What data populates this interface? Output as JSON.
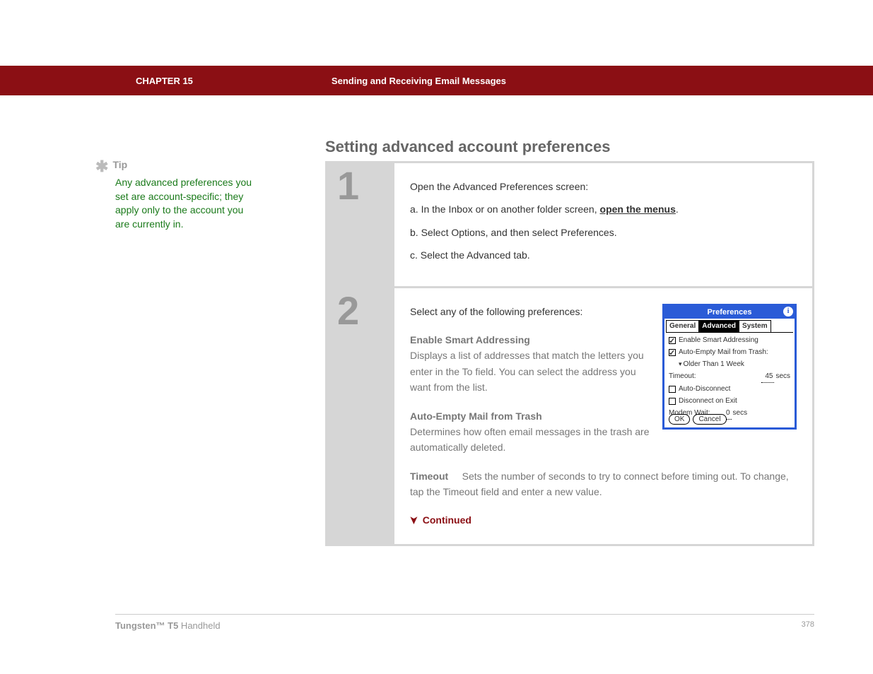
{
  "header": {
    "chapter": "CHAPTER 15",
    "title": "Sending and Receiving Email Messages"
  },
  "sidebar": {
    "tip_label": "Tip",
    "tip_text": "Any advanced preferences you set are account-specific; they apply only to the account you are currently in."
  },
  "section_title": "Setting advanced account preferences",
  "step1": {
    "num": "1",
    "intro": "Open the Advanced Preferences screen:",
    "a_prefix": "a.  In the Inbox or on another folder screen, ",
    "a_link": "open the menus",
    "a_suffix": ".",
    "b": "b.  Select Options, and then select Preferences.",
    "c": "c.  Select the Advanced tab."
  },
  "step2": {
    "num": "2",
    "intro": "Select any of the following preferences:",
    "pref1_title": "Enable Smart Addressing",
    "pref1_desc": "Displays a list of addresses that match the letters you enter in the To field. You can select the address you want from the list.",
    "pref2_title": "Auto-Empty Mail from Trash",
    "pref2_desc": "Determines how often email messages in the trash are automatically deleted.",
    "pref3_title": "Timeout",
    "pref3_desc": "Sets the number of seconds to try to connect before timing out. To change, tap the Timeout field and enter a new value.",
    "continued": "Continued"
  },
  "screenshot": {
    "title": "Preferences",
    "tabs": {
      "general": "General",
      "advanced": "Advanced",
      "system": "System"
    },
    "chk1": "Enable Smart Addressing",
    "chk2": "Auto-Empty Mail from Trash:",
    "sub": "Older Than 1 Week",
    "timeout_label": "Timeout:",
    "timeout_value": "45",
    "timeout_unit": "secs",
    "chk3": "Auto-Disconnect",
    "chk4": "Disconnect on Exit",
    "modem_label": "Modem Wait:",
    "modem_value": "0",
    "modem_unit": "secs",
    "ok": "OK",
    "cancel": "Cancel"
  },
  "footer": {
    "product_bold": "Tungsten™ T5",
    "product_light": " Handheld",
    "page": "378"
  }
}
